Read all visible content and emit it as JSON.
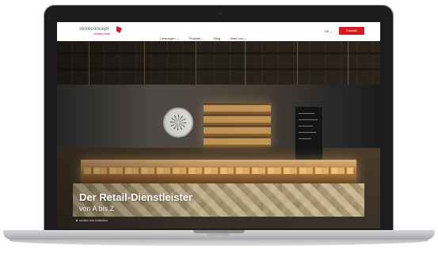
{
  "device": {
    "brand": "MacBook"
  },
  "site": {
    "logo": {
      "name": "storeconcept",
      "tagline": "creating retail"
    },
    "nav": [
      {
        "label": "Leistungen ⌄"
      },
      {
        "label": "Projekte ⌄"
      },
      {
        "label": "Blog"
      },
      {
        "label": "Über uns ⌄"
      }
    ],
    "language": "DE ⌄",
    "contact_label": "Kontakt",
    "colors": {
      "accent": "#d71920",
      "nav_bg": "#ffffff"
    }
  },
  "hero": {
    "title": "Der Retail-Dienstleister",
    "subtitle": "von A bis Z",
    "scroll_hint": "scrollen und entdecken"
  }
}
